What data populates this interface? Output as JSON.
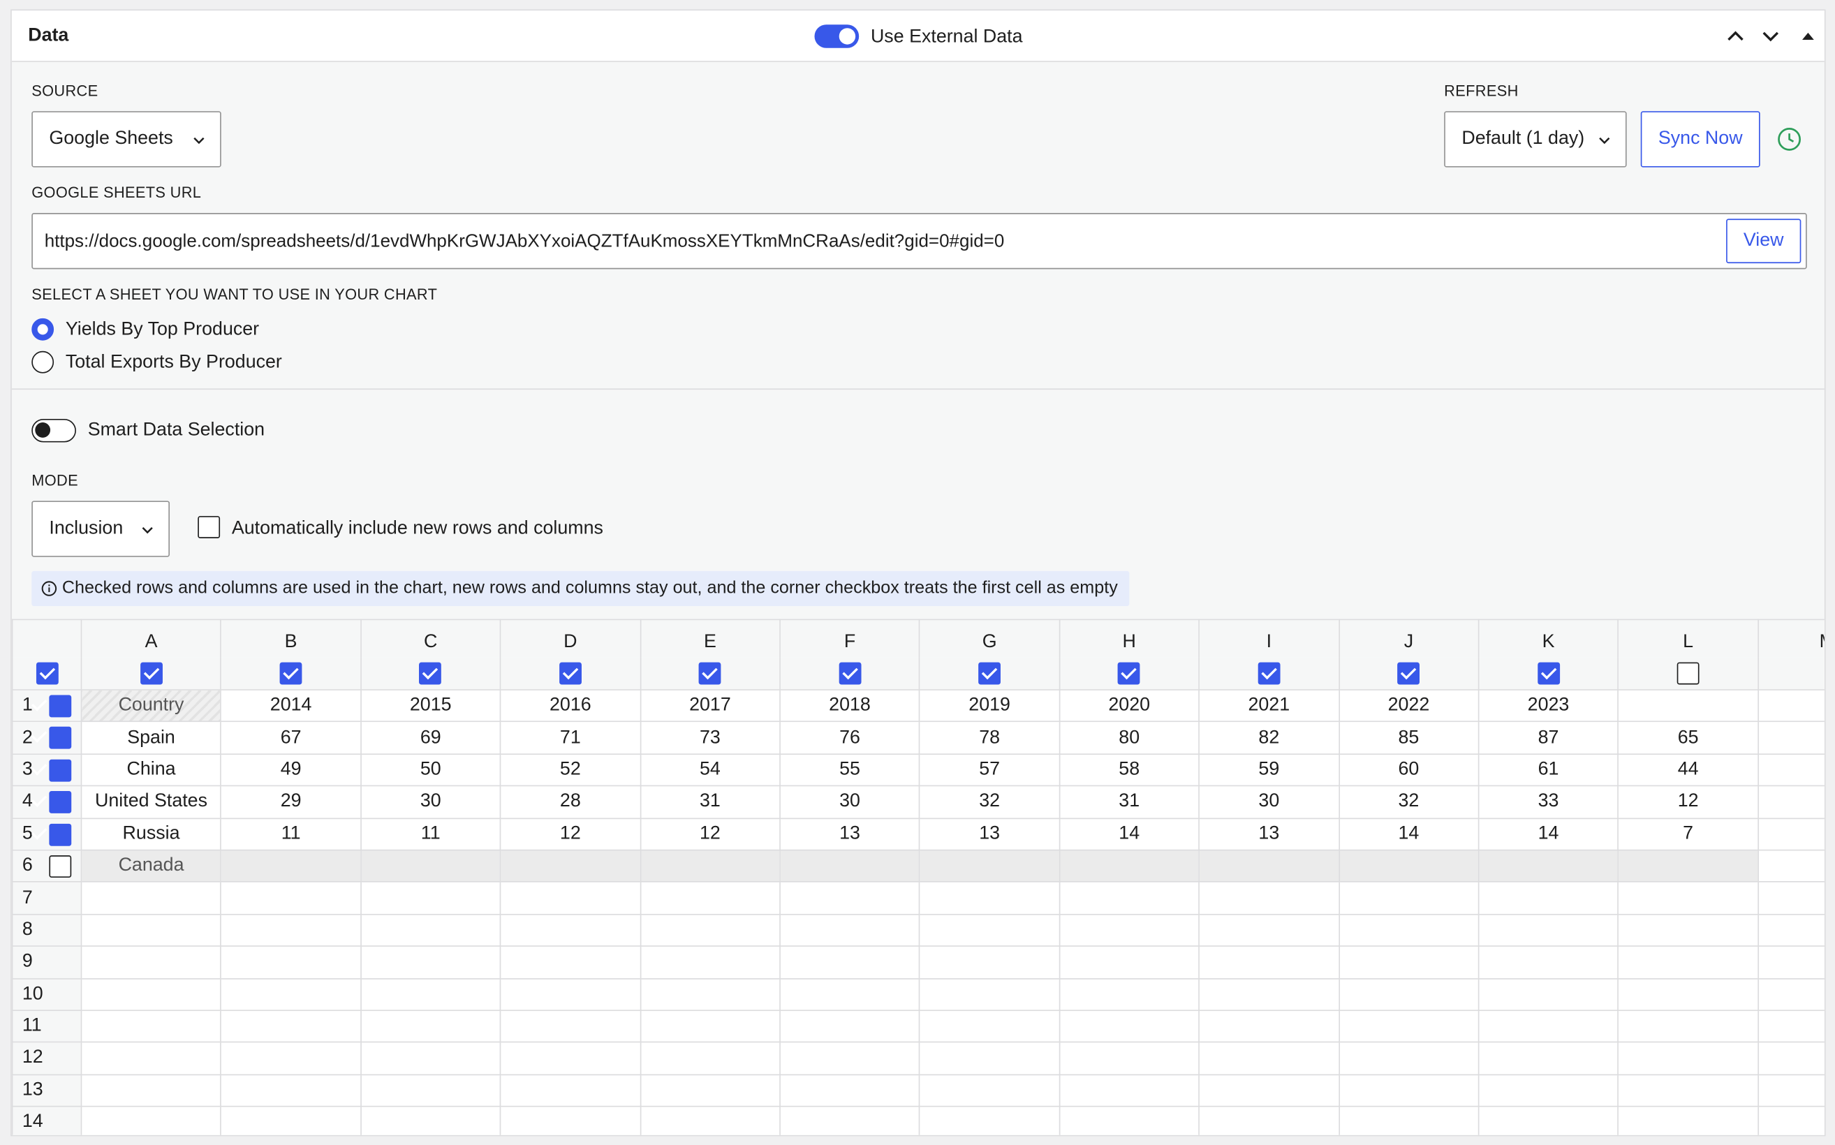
{
  "panel": {
    "title": "Data",
    "external_toggle_label": "Use External Data"
  },
  "source": {
    "label": "SOURCE",
    "value": "Google Sheets"
  },
  "refresh": {
    "label": "REFRESH",
    "value": "Default (1 day)",
    "sync_label": "Sync Now"
  },
  "url": {
    "label": "GOOGLE SHEETS URL",
    "value": "https://docs.google.com/spreadsheets/d/1evdWhpKrGWJAbXYxoiAQZTfAuKmossXEYTkmMnCRaAs/edit?gid=0#gid=0",
    "view_label": "View"
  },
  "sheets": {
    "label": "SELECT A SHEET YOU WANT TO USE IN YOUR CHART",
    "options": [
      "Yields By Top Producer",
      "Total Exports By Producer"
    ],
    "selected": 0
  },
  "smart": {
    "label": "Smart Data Selection"
  },
  "mode": {
    "label": "MODE",
    "value": "Inclusion",
    "auto_label": "Automatically include new rows and columns"
  },
  "info": "Checked rows and columns are used in the chart, new rows and columns stay out, and the corner checkbox treats the first cell as empty",
  "table": {
    "columns": [
      "A",
      "B",
      "C",
      "D",
      "E",
      "F",
      "G",
      "H",
      "I",
      "J",
      "K",
      "L",
      "M"
    ],
    "col_checked": [
      true,
      true,
      true,
      true,
      true,
      true,
      true,
      true,
      true,
      true,
      true,
      false
    ],
    "rows": [
      {
        "n": "1",
        "checked": true,
        "cells": [
          "Country",
          "2014",
          "2015",
          "2016",
          "2017",
          "2018",
          "2019",
          "2020",
          "2021",
          "2022",
          "2023",
          ""
        ]
      },
      {
        "n": "2",
        "checked": true,
        "cells": [
          "Spain",
          "67",
          "69",
          "71",
          "73",
          "76",
          "78",
          "80",
          "82",
          "85",
          "87",
          "65"
        ]
      },
      {
        "n": "3",
        "checked": true,
        "cells": [
          "China",
          "49",
          "50",
          "52",
          "54",
          "55",
          "57",
          "58",
          "59",
          "60",
          "61",
          "44"
        ]
      },
      {
        "n": "4",
        "checked": true,
        "cells": [
          "United States",
          "29",
          "30",
          "28",
          "31",
          "30",
          "32",
          "31",
          "30",
          "32",
          "33",
          "12"
        ]
      },
      {
        "n": "5",
        "checked": true,
        "cells": [
          "Russia",
          "11",
          "11",
          "12",
          "12",
          "13",
          "13",
          "14",
          "13",
          "14",
          "14",
          "7"
        ]
      },
      {
        "n": "6",
        "checked": false,
        "cells": [
          "Canada",
          "",
          "",
          "",
          "",
          "",
          "",
          "",
          "",
          "",
          "",
          ""
        ]
      },
      {
        "n": "7",
        "checked": null,
        "cells": [
          "",
          "",
          "",
          "",
          "",
          "",
          "",
          "",
          "",
          "",
          "",
          ""
        ]
      },
      {
        "n": "8",
        "checked": null,
        "cells": [
          "",
          "",
          "",
          "",
          "",
          "",
          "",
          "",
          "",
          "",
          "",
          ""
        ]
      },
      {
        "n": "9",
        "checked": null,
        "cells": [
          "",
          "",
          "",
          "",
          "",
          "",
          "",
          "",
          "",
          "",
          "",
          ""
        ]
      },
      {
        "n": "10",
        "checked": null,
        "cells": [
          "",
          "",
          "",
          "",
          "",
          "",
          "",
          "",
          "",
          "",
          "",
          ""
        ]
      },
      {
        "n": "11",
        "checked": null,
        "cells": [
          "",
          "",
          "",
          "",
          "",
          "",
          "",
          "",
          "",
          "",
          "",
          ""
        ]
      },
      {
        "n": "12",
        "checked": null,
        "cells": [
          "",
          "",
          "",
          "",
          "",
          "",
          "",
          "",
          "",
          "",
          "",
          ""
        ]
      },
      {
        "n": "13",
        "checked": null,
        "cells": [
          "",
          "",
          "",
          "",
          "",
          "",
          "",
          "",
          "",
          "",
          "",
          ""
        ]
      },
      {
        "n": "14",
        "checked": null,
        "cells": [
          "",
          "",
          "",
          "",
          "",
          "",
          "",
          "",
          "",
          "",
          "",
          ""
        ]
      }
    ]
  },
  "colors": {
    "accent": "#3858e9",
    "clock": "#2e9e5a",
    "info_bg": "#e6ecfb",
    "excluded_bg": "#ebebeb"
  }
}
